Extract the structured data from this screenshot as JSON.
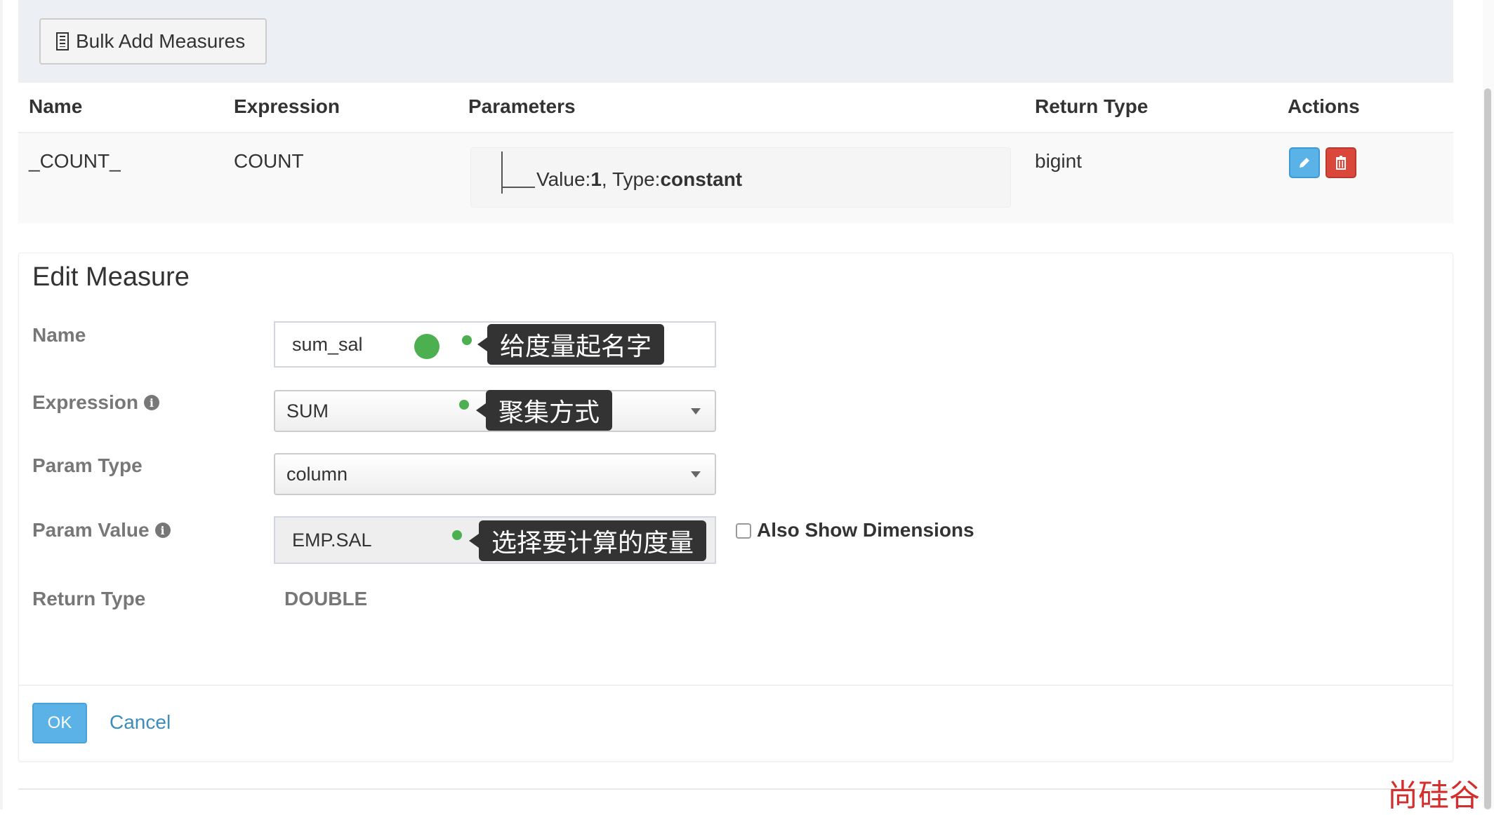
{
  "toolbar": {
    "bulk_add_label": "Bulk Add Measures"
  },
  "table": {
    "headers": [
      "Name",
      "Expression",
      "Parameters",
      "Return Type",
      "Actions"
    ],
    "rows": [
      {
        "name": "_COUNT_",
        "expression": "COUNT",
        "param_value_label": "Value:",
        "param_value": "1",
        "param_sep": ", ",
        "param_type_label": "Type:",
        "param_type": "constant",
        "return_type": "bigint"
      }
    ]
  },
  "edit_measure": {
    "title": "Edit Measure",
    "name_label": "Name",
    "name_value": "sum_sal",
    "expression_label": "Expression",
    "expression_value": "SUM",
    "param_type_label": "Param Type",
    "param_type_value": "column",
    "param_value_label": "Param Value",
    "param_value_value": "EMP.SAL",
    "also_show_dimensions_label": "Also Show Dimensions",
    "return_type_label": "Return Type",
    "return_type_value": "DOUBLE",
    "ok_label": "OK",
    "cancel_label": "Cancel"
  },
  "annotations": {
    "name_tip": "给度量起名字",
    "expression_tip": "聚集方式",
    "param_value_tip": "选择要计算的度量"
  },
  "watermark": "尚硅谷",
  "colors": {
    "primary": "#5bb2e6",
    "danger": "#d9483b",
    "link": "#3c8dbc",
    "annotation_dot": "#4caf50",
    "tooltip_bg": "#333333"
  },
  "icons": {
    "bulk_add": "building-icon",
    "edit": "pencil-icon",
    "delete": "trash-icon",
    "info": "info-icon",
    "select": "caret-down-icon"
  }
}
